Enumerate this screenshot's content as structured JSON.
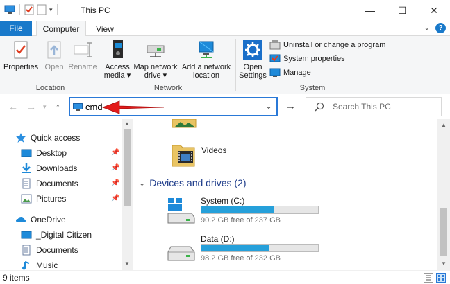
{
  "window": {
    "title": "This PC",
    "minimize": "—",
    "maximize": "☐",
    "close": "✕"
  },
  "tabs": {
    "file": "File",
    "computer": "Computer",
    "view": "View"
  },
  "ribbon": {
    "location": {
      "label": "Location",
      "properties": "Properties",
      "open": "Open",
      "rename": "Rename"
    },
    "network": {
      "label": "Network",
      "access_media_1": "Access",
      "access_media_2": "media ▾",
      "map_drive_1": "Map network",
      "map_drive_2": "drive ▾",
      "add_location_1": "Add a network",
      "add_location_2": "location"
    },
    "system": {
      "label": "System",
      "open_settings_1": "Open",
      "open_settings_2": "Settings",
      "uninstall": "Uninstall or change a program",
      "system_properties": "System properties",
      "manage": "Manage"
    }
  },
  "address": {
    "value": "cmd",
    "search_placeholder": "Search This PC"
  },
  "left_pane": {
    "items": [
      {
        "label": "Quick access"
      },
      {
        "label": "Desktop"
      },
      {
        "label": "Downloads"
      },
      {
        "label": "Documents"
      },
      {
        "label": "Pictures"
      },
      {
        "label": "OneDrive"
      },
      {
        "label": "_Digital Citizen"
      },
      {
        "label": "Documents"
      },
      {
        "label": "Music"
      }
    ]
  },
  "content": {
    "videos_label": "Videos",
    "group_header": "Devices and drives (2)",
    "drives": [
      {
        "name": "System (C:)",
        "free": "90.2 GB free of 237 GB",
        "used_fraction": 0.62
      },
      {
        "name": "Data (D:)",
        "free": "98.2 GB free of 232 GB",
        "used_fraction": 0.58
      }
    ]
  },
  "status": {
    "items": "9 items"
  },
  "colors": {
    "accent": "#1979ca",
    "drive_bar": "#26a0da",
    "group_header": "#1e3c8a",
    "annotation_arrow": "#e31b1b"
  }
}
